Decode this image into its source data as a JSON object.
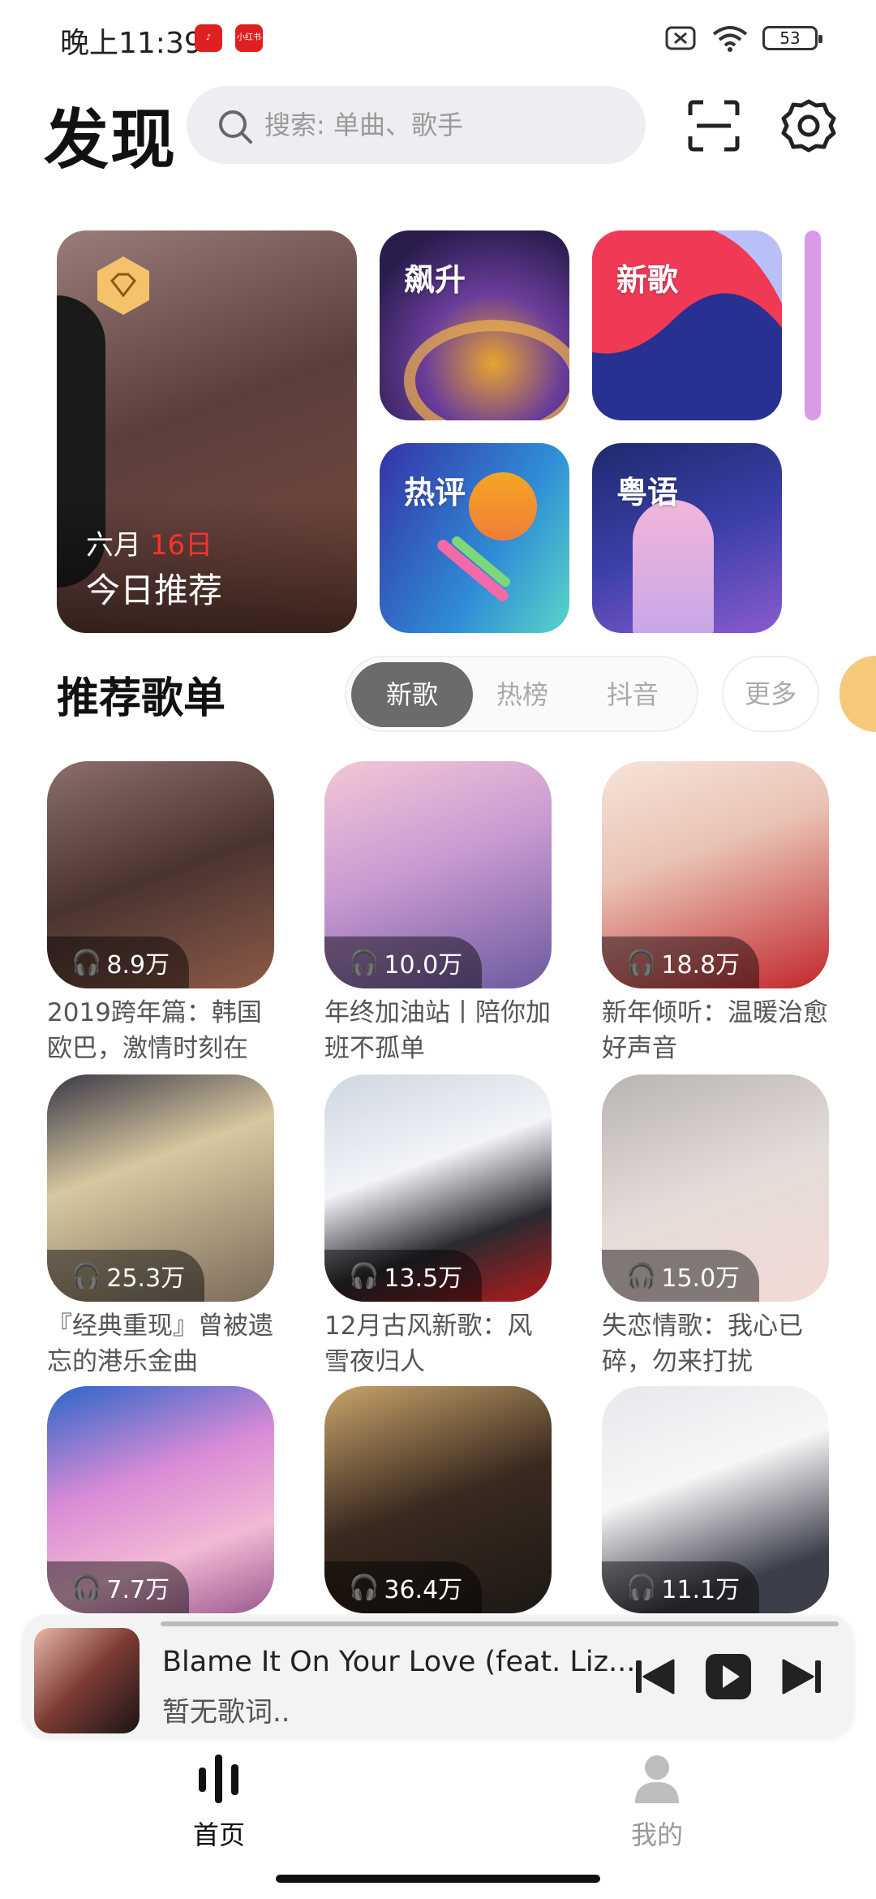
{
  "status_bar": {
    "time": "晚上11:39",
    "app_badge": "小红书",
    "battery": "53"
  },
  "header": {
    "title": "发现",
    "search_placeholder": "搜索: 单曲、歌手"
  },
  "features": {
    "daily": {
      "month": "六月",
      "day": "16日",
      "label": "今日推荐"
    },
    "tiles": [
      "飙升",
      "新歌",
      "热评",
      "粤语"
    ]
  },
  "playlists_section": {
    "title": "推荐歌单",
    "tabs": [
      "新歌",
      "热榜",
      "抖音"
    ],
    "more": "更多"
  },
  "playlists": [
    {
      "plays": "8.9万",
      "name": "2019跨年篇：韩国欧巴，激情时刻在"
    },
    {
      "plays": "10.0万",
      "name": "年终加油站丨陪你加班不孤单"
    },
    {
      "plays": "18.8万",
      "name": "新年倾听：温暖治愈好声音"
    },
    {
      "plays": "25.3万",
      "name": "『经典重现』曾被遗忘的港乐金曲"
    },
    {
      "plays": "13.5万",
      "name": "12月古风新歌：风雪夜归人"
    },
    {
      "plays": "15.0万",
      "name": "失恋情歌：我心已碎，勿来打扰"
    },
    {
      "plays": "7.7万",
      "name": ""
    },
    {
      "plays": "36.4万",
      "name": ""
    },
    {
      "plays": "11.1万",
      "name": ""
    }
  ],
  "player": {
    "song": "Blame It On Your Love (feat. Liz...",
    "lyric": "暂无歌词.."
  },
  "nav": {
    "home": "首页",
    "mine": "我的"
  },
  "colors": {
    "accent_red": "#e02020",
    "tab_active": "#6b6b6b"
  }
}
